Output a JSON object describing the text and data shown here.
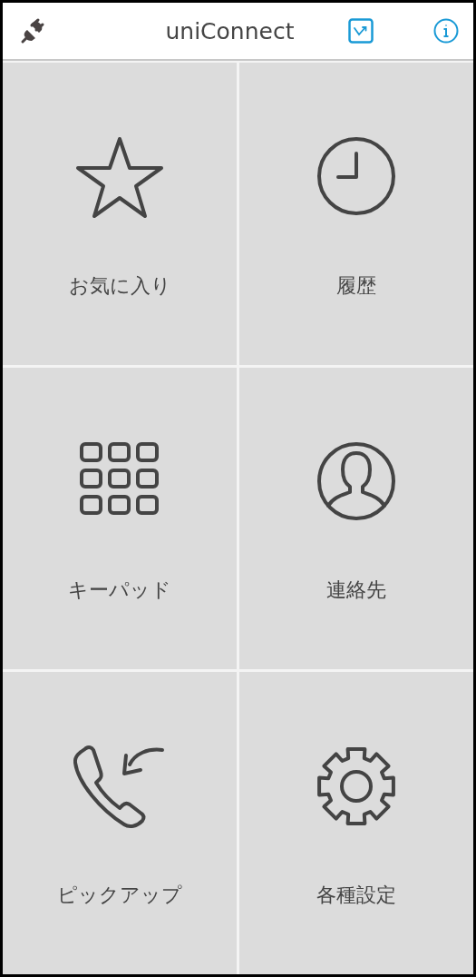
{
  "header": {
    "title": "uniConnect"
  },
  "tiles": [
    {
      "kind": "star",
      "label": "お気に入り"
    },
    {
      "kind": "clock",
      "label": "履歴"
    },
    {
      "kind": "keypad",
      "label": "キーパッド"
    },
    {
      "kind": "contact",
      "label": "連絡先"
    },
    {
      "kind": "pickup",
      "label": "ピックアップ"
    },
    {
      "kind": "gear",
      "label": "各種設定"
    }
  ]
}
